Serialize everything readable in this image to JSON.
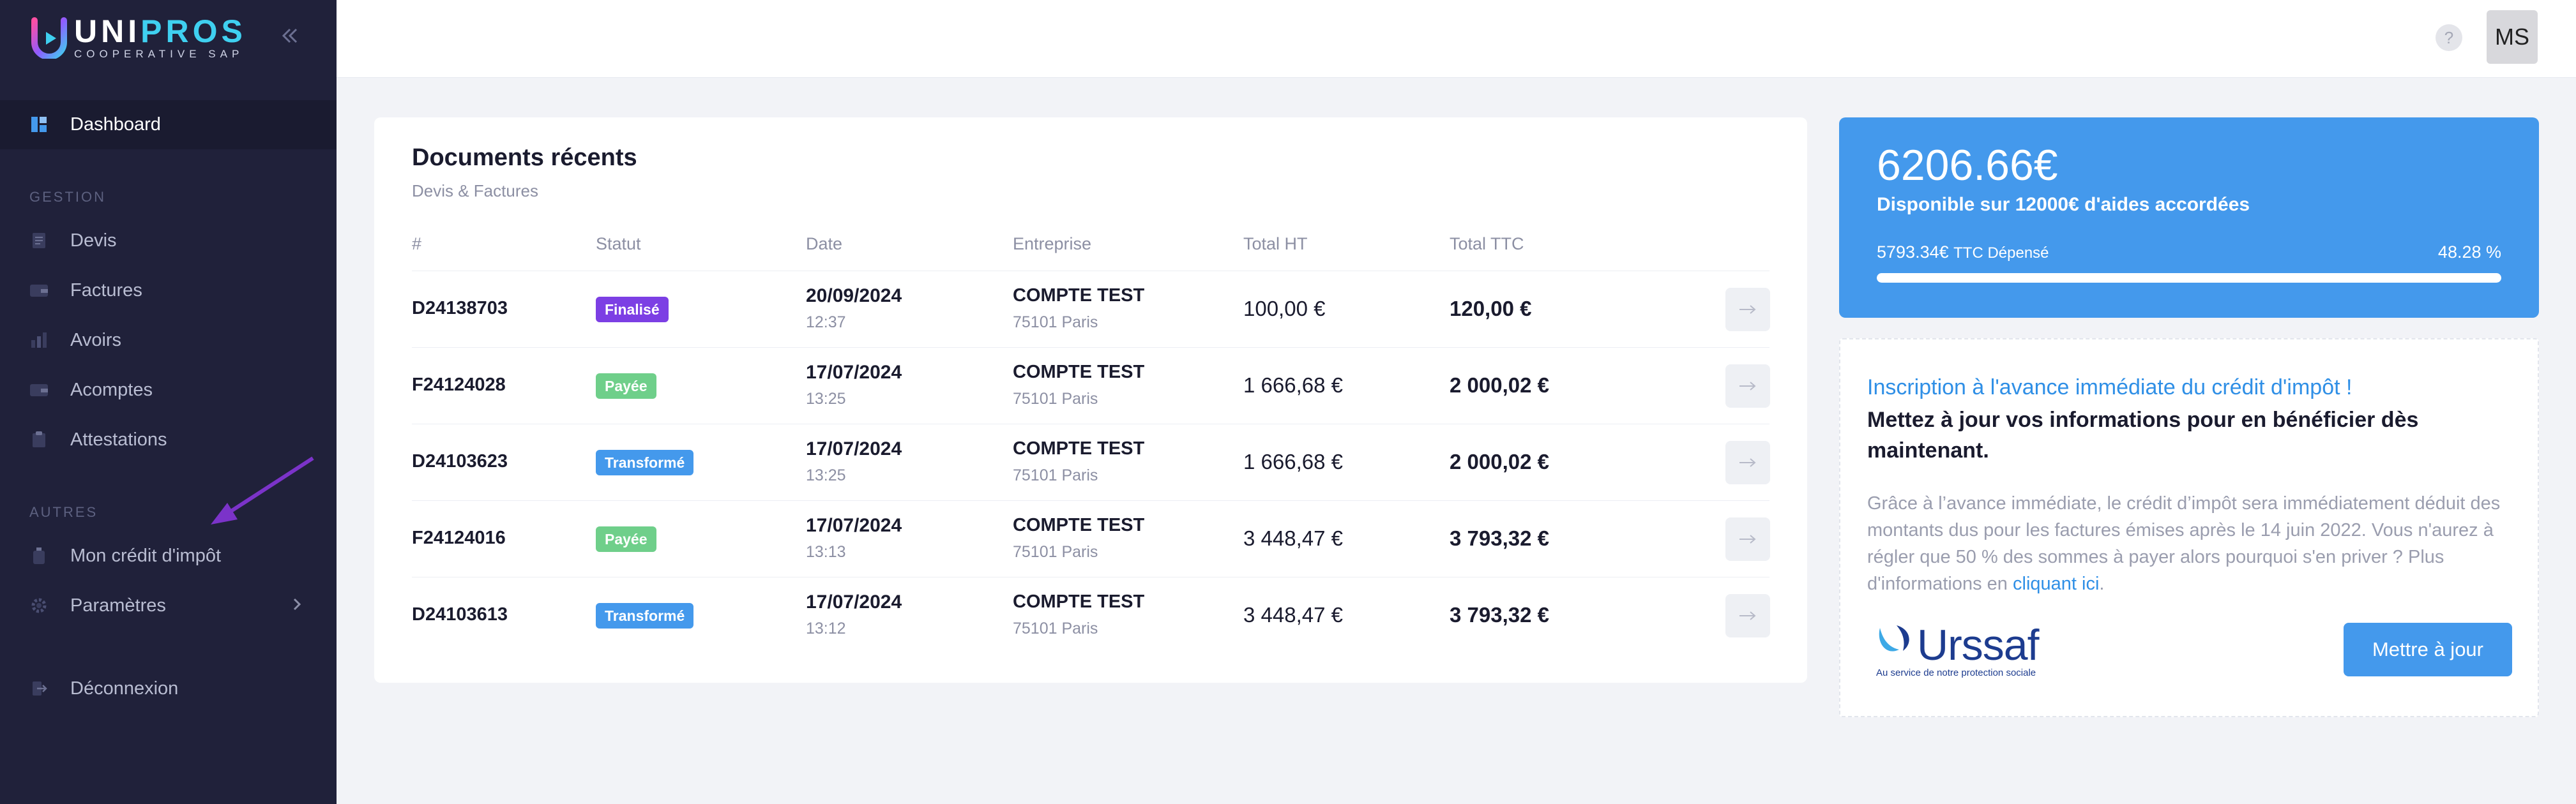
{
  "brand": {
    "name_prefix": "UNI",
    "name_suffix": "PROS",
    "subtitle": "COOPERATIVE SAP"
  },
  "sidebar": {
    "dashboard": "Dashboard",
    "sections": {
      "gestion": "GESTION",
      "autres": "AUTRES"
    },
    "items": {
      "devis": "Devis",
      "factures": "Factures",
      "avoirs": "Avoirs",
      "acomptes": "Acomptes",
      "attestations": "Attestations",
      "credit": "Mon crédit d'impôt",
      "parametres": "Paramètres",
      "deconnexion": "Déconnexion"
    }
  },
  "topbar": {
    "help": "?",
    "avatar": "MS"
  },
  "documents": {
    "title": "Documents récents",
    "subtitle": "Devis & Factures",
    "headers": {
      "num": "#",
      "statut": "Statut",
      "date": "Date",
      "entreprise": "Entreprise",
      "total_ht": "Total HT",
      "total_ttc": "Total TTC"
    },
    "rows": [
      {
        "num": "D24138703",
        "status": "Finalisé",
        "status_color": "#7c3fe4",
        "date": "20/09/2024",
        "time": "12:37",
        "company": "COMPTE TEST",
        "city": "75101 Paris",
        "ht": "100,00 €",
        "ttc": "120,00 €"
      },
      {
        "num": "F24124028",
        "status": "Payée",
        "status_color": "#6fcf8a",
        "date": "17/07/2024",
        "time": "13:25",
        "company": "COMPTE TEST",
        "city": "75101 Paris",
        "ht": "1 666,68 €",
        "ttc": "2 000,02 €"
      },
      {
        "num": "D24103623",
        "status": "Transformé",
        "status_color": "#4499ec",
        "date": "17/07/2024",
        "time": "13:25",
        "company": "COMPTE TEST",
        "city": "75101 Paris",
        "ht": "1 666,68 €",
        "ttc": "2 000,02 €"
      },
      {
        "num": "F24124016",
        "status": "Payée",
        "status_color": "#6fcf8a",
        "date": "17/07/2024",
        "time": "13:13",
        "company": "COMPTE TEST",
        "city": "75101 Paris",
        "ht": "3 448,47 €",
        "ttc": "3 793,32 €"
      },
      {
        "num": "D24103613",
        "status": "Transformé",
        "status_color": "#4499ec",
        "date": "17/07/2024",
        "time": "13:12",
        "company": "COMPTE TEST",
        "city": "75101 Paris",
        "ht": "3 448,47 €",
        "ttc": "3 793,32 €"
      }
    ]
  },
  "aid": {
    "amount": "6206.66€",
    "description": "Disponible sur 12000€ d'aides accordées",
    "spent": "5793.34€",
    "spent_label": "TTC Dépensé",
    "percent": "48.28 %",
    "progress_fraction": 1.0
  },
  "credit_info": {
    "link_title": "Inscription à l'avance immédiate du crédit d'impôt !",
    "title": "Mettez à jour vos informations pour en bénéficier dès maintenant.",
    "body": "Grâce à l’avance immédiate, le crédit d’impôt sera immédiatement déduit des montants dus pour les factures émises après le 14 juin 2022. Vous n'aurez à régler que 50 % des sommes à payer alors pourquoi s'en priver ? Plus d'informations en",
    "link": "cliquant ici",
    "body_end": ".",
    "urssaf_name": "Urssaf",
    "urssaf_tagline": "Au service de notre protection sociale",
    "button": "Mettre à jour"
  },
  "colors": {
    "sidebar": "#20213a",
    "accent": "#4499ec",
    "finalise": "#7c3fe4",
    "payee": "#6fcf8a"
  }
}
